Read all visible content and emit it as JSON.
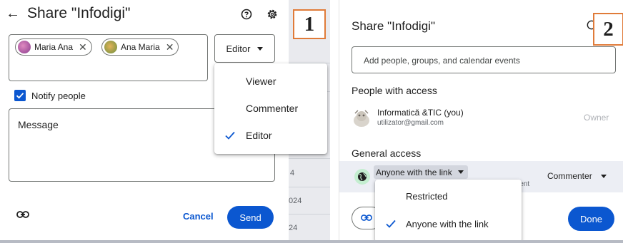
{
  "panel1": {
    "title": "Share \"Infodigi\"",
    "back_icon": "arrow-left-icon",
    "recipients": [
      {
        "name": "Maria Ana",
        "avatar_color": "#a05aa8"
      },
      {
        "name": "Ana Maria",
        "avatar_color": "#8fae5a"
      }
    ],
    "role_button": "Editor",
    "role_menu": [
      {
        "label": "Viewer",
        "selected": false
      },
      {
        "label": "Commenter",
        "selected": false
      },
      {
        "label": "Editor",
        "selected": true
      }
    ],
    "notify_label": "Notify people",
    "notify_checked": true,
    "message_placeholder": "Message",
    "cancel_label": "Cancel",
    "send_label": "Send",
    "background_cells": [
      "4",
      "024",
      "24"
    ],
    "badge": "1"
  },
  "panel2": {
    "title": "Share \"Infodigi\"",
    "input_placeholder": "Add people, groups, and calendar events",
    "people_heading": "People with access",
    "owner": {
      "name": "Informatică &TIC (you)",
      "email": "utilizator@gmail.com",
      "role": "Owner"
    },
    "general_heading": "General access",
    "link_access": "Anyone with the link",
    "link_subtext": "ient",
    "link_role": "Commenter",
    "access_menu": [
      {
        "label": "Restricted",
        "selected": false
      },
      {
        "label": "Anyone with the link",
        "selected": true
      }
    ],
    "done_label": "Done",
    "badge": "2"
  },
  "colors": {
    "primary": "#0b57d0",
    "badge_border": "#e07b39",
    "globe_bg": "#c4eed0",
    "selected_row": "#eceef4"
  }
}
